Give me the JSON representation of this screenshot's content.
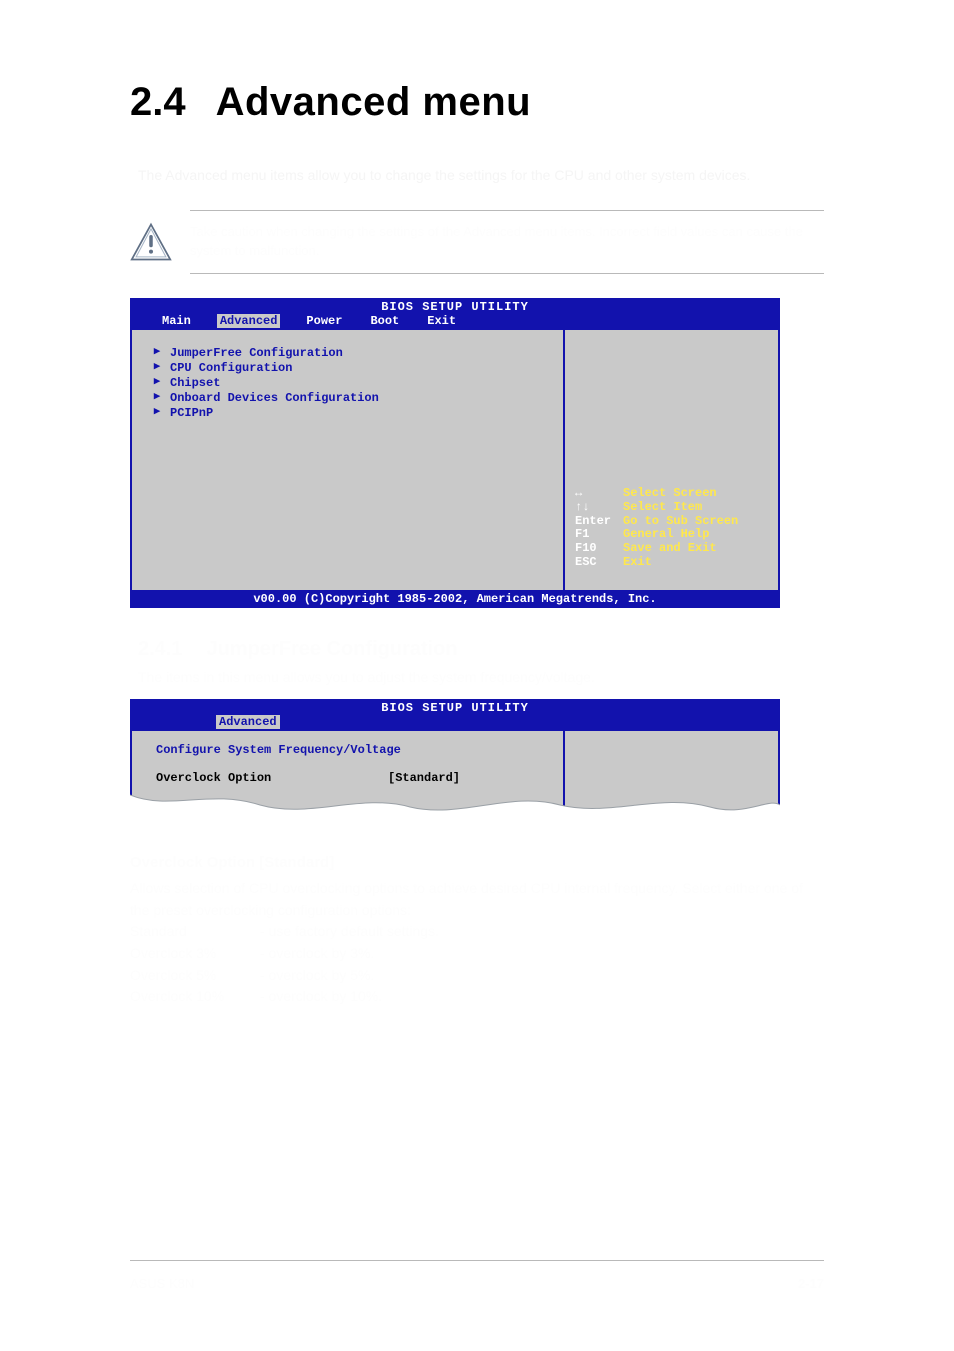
{
  "heading": {
    "number": "2.4",
    "title": "Advanced menu"
  },
  "intro": "The Advanced menu items allow you to change the settings for the CPU and other system devices.",
  "caution": "Take caution when changing the settings of the Advanced menu items. Incorrect field values can cause the system to malfunction.",
  "bios1": {
    "title": "BIOS SETUP UTILITY",
    "tabs": [
      "Main",
      "Advanced",
      "Power",
      "Boot",
      "Exit"
    ],
    "active_tab": "Advanced",
    "items": [
      "JumperFree Configuration",
      "CPU Configuration",
      "Chipset",
      "Onboard Devices Configuration",
      "PCIPnP"
    ],
    "nav": [
      {
        "key": "↔",
        "desc": "Select Screen"
      },
      {
        "key": "↑↓",
        "desc": "Select Item"
      },
      {
        "key": "Enter",
        "desc": "Go to Sub Screen"
      },
      {
        "key": "F1",
        "desc": "General Help"
      },
      {
        "key": "F10",
        "desc": "Save and Exit"
      },
      {
        "key": "ESC",
        "desc": "Exit"
      }
    ],
    "copyright": "v00.00 (C)Copyright 1985-2002, American Megatrends, Inc."
  },
  "subsection": {
    "number": "2.4.1",
    "title": "JumperFree Configuration",
    "intro": "The items in this menu allows you to adjust the system frequency/voltage."
  },
  "bios2": {
    "title": "BIOS SETUP UTILITY",
    "active_tab": "Advanced",
    "panel_title": "Configure System Frequency/Voltage",
    "option_label": "Overclock Option",
    "option_value": "[Standard]"
  },
  "option": {
    "heading": "Overclock Option [Standard]",
    "desc": "Allows selection of CPU overclocking options to achieve desired CPU internal frequency. Select either one of the preset overclocking configuration options:",
    "rows": [
      {
        "label": "Standard",
        "text": "- use factory default settings."
      },
      {
        "label": "Overclock 3%",
        "text": "- overclock by 3%."
      },
      {
        "label": "Overclock 5%",
        "text": "- overclock by 5%."
      },
      {
        "label": "Overclock 10%",
        "text": "- overclock by 10%."
      }
    ]
  },
  "footer": {
    "left": "ASUS K8N",
    "right": "2-17"
  }
}
